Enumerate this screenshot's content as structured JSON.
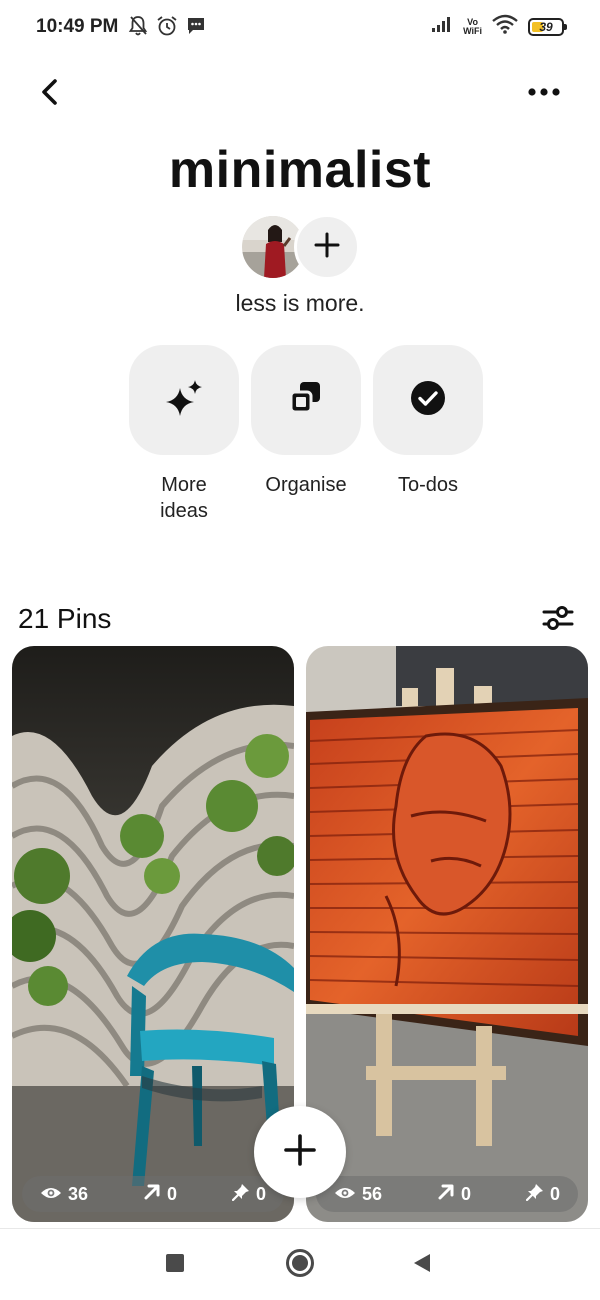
{
  "status_bar": {
    "time": "10:49 PM",
    "network_label_top": "Vo",
    "network_label_bottom": "WiFi",
    "battery": "39",
    "battery_level": 0.39,
    "icons": [
      "mute-bell-icon",
      "alarm-icon",
      "message-icon",
      "signal-icon",
      "wifi-icon",
      "battery-icon"
    ]
  },
  "header": {
    "back_icon": "chevron-left-icon",
    "more_icon": "ellipsis-icon"
  },
  "board": {
    "title": "minimalist",
    "description": "less is more."
  },
  "actions": [
    {
      "label": "More ideas",
      "icon": "sparkle-icon"
    },
    {
      "label": "Organise",
      "icon": "organise-icon"
    },
    {
      "label": "To-dos",
      "icon": "check-circle-icon"
    }
  ],
  "pins_header": {
    "count_label": "21 Pins",
    "filter_icon": "sliders-icon"
  },
  "pins": [
    {
      "subject": "blue chair",
      "views": "36",
      "clicks": "0",
      "saves": "0"
    },
    {
      "subject": "wood face art",
      "views": "56",
      "clicks": "0",
      "saves": "0"
    }
  ],
  "colors": {
    "tile_bg": "#efefef",
    "battery_fill": "#f3c024",
    "text": "#111111"
  }
}
